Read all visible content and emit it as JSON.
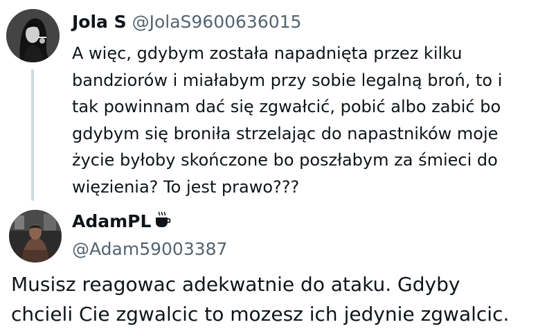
{
  "tweet": {
    "display_name": "Jola S",
    "handle": "@JolaS9600636015",
    "avatar_icon": "woman-smoking-avatar",
    "text_lines": [
      "A więc, gdybym została napadnięta przez kilku",
      "bandziorów i miałabym przy sobie legalną broń, to i",
      "tak powinnam dać się zgwałcić, pobić albo zabić bo",
      "gdybym się broniła strzelając do napastników moje",
      "życie byłoby skończone bo poszłabym za śmieci do",
      "więzienia? To jest prawo???"
    ]
  },
  "reply": {
    "display_name": "AdamPL",
    "name_emoji": "coffee-cup-icon",
    "handle": "@Adam59003387",
    "avatar_icon": "gym-photo-avatar",
    "text_lines": [
      "Musisz reagowac adekwatnie do ataku. Gdyby",
      "chcieli Cie zgwalcic to mozesz ich jedynie zgwalcic."
    ]
  },
  "colors": {
    "text": "#0f1419",
    "secondary_text": "#536471",
    "thread_line": "#cfd9de"
  }
}
